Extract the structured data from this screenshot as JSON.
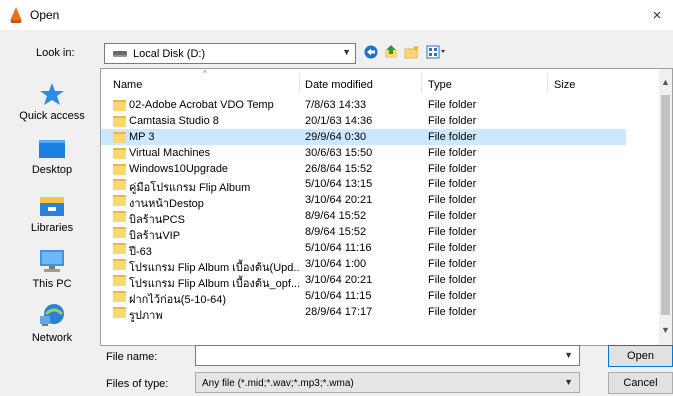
{
  "window": {
    "title": "Open",
    "close_glyph": "×"
  },
  "look_in": {
    "label": "Look in:",
    "value": "Local Disk (D:)"
  },
  "toolbar": {
    "icons": [
      "back-arrow-icon",
      "up-folder-icon",
      "new-folder-icon",
      "view-menu-icon"
    ]
  },
  "places": [
    {
      "label": "Quick access",
      "icon": "star-icon"
    },
    {
      "label": "Desktop",
      "icon": "desktop-icon"
    },
    {
      "label": "Libraries",
      "icon": "libraries-icon"
    },
    {
      "label": "This PC",
      "icon": "pc-icon"
    },
    {
      "label": "Network",
      "icon": "network-icon"
    }
  ],
  "columns": {
    "name": "Name",
    "date": "Date modified",
    "type": "Type",
    "size": "Size"
  },
  "files": [
    {
      "name": "02-Adobe Acrobat VDO Temp",
      "date": "7/8/63 14:33",
      "type": "File folder",
      "selected": false
    },
    {
      "name": "Camtasia Studio 8",
      "date": "20/1/63 14:36",
      "type": "File folder",
      "selected": false
    },
    {
      "name": "MP 3",
      "date": "29/9/64 0:30",
      "type": "File folder",
      "selected": true
    },
    {
      "name": "Virtual Machines",
      "date": "30/6/63 15:50",
      "type": "File folder",
      "selected": false
    },
    {
      "name": "Windows10Upgrade",
      "date": "26/8/64 15:52",
      "type": "File folder",
      "selected": false
    },
    {
      "name": "คู่มือโปรแกรม Flip Album",
      "date": "5/10/64 13:15",
      "type": "File folder",
      "selected": false
    },
    {
      "name": "งานหน้าDestop",
      "date": "3/10/64 20:21",
      "type": "File folder",
      "selected": false
    },
    {
      "name": "บิลร้านPCS",
      "date": "8/9/64 15:52",
      "type": "File folder",
      "selected": false
    },
    {
      "name": "บิลร้านVIP",
      "date": "8/9/64 15:52",
      "type": "File folder",
      "selected": false
    },
    {
      "name": "ปี-63",
      "date": "5/10/64 11:16",
      "type": "File folder",
      "selected": false
    },
    {
      "name": "โปรแกรม Flip Album เบื้องต้น(Upd...",
      "date": "3/10/64 1:00",
      "type": "File folder",
      "selected": false
    },
    {
      "name": "โปรแกรม Flip Album เบื้องต้น_opf...",
      "date": "3/10/64 20:21",
      "type": "File folder",
      "selected": false
    },
    {
      "name": "ฝากไว้ก่อน(5-10-64)",
      "date": "5/10/64 11:15",
      "type": "File folder",
      "selected": false
    },
    {
      "name": "รูปภาพ",
      "date": "28/9/64 17:17",
      "type": "File folder",
      "selected": false
    }
  ],
  "file_name": {
    "label": "File name:",
    "value": ""
  },
  "file_type": {
    "label": "Files of type:",
    "value": "Any file (*.mid;*.wav;*.mp3;*.wma)"
  },
  "buttons": {
    "open": "Open",
    "cancel": "Cancel"
  },
  "colors": {
    "selection": "#cce8ff",
    "folder": "#f8d775",
    "accent": "#0078d7"
  }
}
